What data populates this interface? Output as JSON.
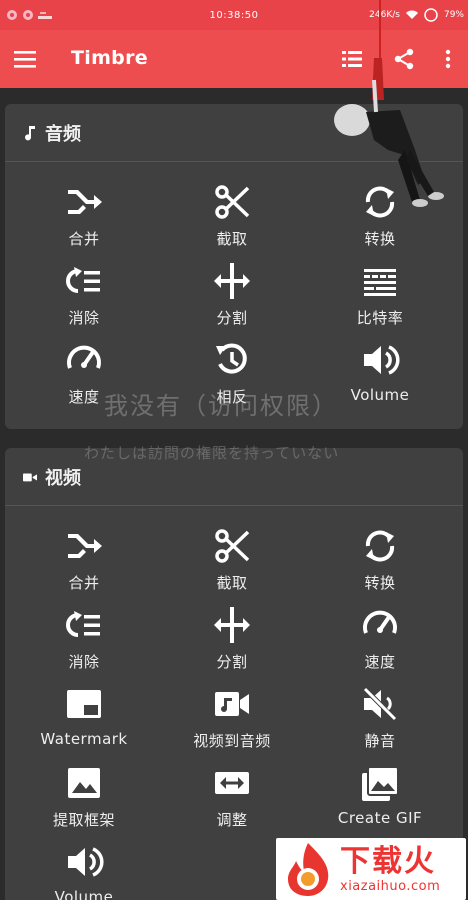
{
  "status": {
    "time": "10:38:50",
    "speed": "246K/s",
    "battery": "79%"
  },
  "appbar": {
    "title": "Timbre"
  },
  "audio": {
    "title": "音频",
    "items": [
      {
        "label": "合并",
        "icon": "merge-icon"
      },
      {
        "label": "截取",
        "icon": "scissors-icon"
      },
      {
        "label": "转换",
        "icon": "convert-icon"
      },
      {
        "label": "消除",
        "icon": "remove-icon"
      },
      {
        "label": "分割",
        "icon": "split-icon"
      },
      {
        "label": "比特率",
        "icon": "bitrate-icon"
      },
      {
        "label": "速度",
        "icon": "speed-icon"
      },
      {
        "label": "相反",
        "icon": "reverse-icon"
      },
      {
        "label": "Volume",
        "icon": "volume-icon"
      }
    ]
  },
  "video": {
    "title": "视频",
    "items": [
      {
        "label": "合并",
        "icon": "merge-icon"
      },
      {
        "label": "截取",
        "icon": "scissors-icon"
      },
      {
        "label": "转换",
        "icon": "convert-icon"
      },
      {
        "label": "消除",
        "icon": "remove-icon"
      },
      {
        "label": "分割",
        "icon": "split-icon"
      },
      {
        "label": "速度",
        "icon": "speed-icon"
      },
      {
        "label": "Watermark",
        "icon": "watermark-icon"
      },
      {
        "label": "视频到音频",
        "icon": "video-to-audio-icon"
      },
      {
        "label": "静音",
        "icon": "mute-icon"
      },
      {
        "label": "提取框架",
        "icon": "image-icon"
      },
      {
        "label": "调整",
        "icon": "resize-icon"
      },
      {
        "label": "Create GIF",
        "icon": "gif-icon"
      },
      {
        "label": "Volume",
        "icon": "volume-icon"
      }
    ]
  },
  "overlay": {
    "cn": "我没有（访问权限）",
    "jp": "わたしは訪問の権限を持っていない"
  },
  "logo": {
    "big": "下载火",
    "small": "xiazaihuo.com"
  }
}
